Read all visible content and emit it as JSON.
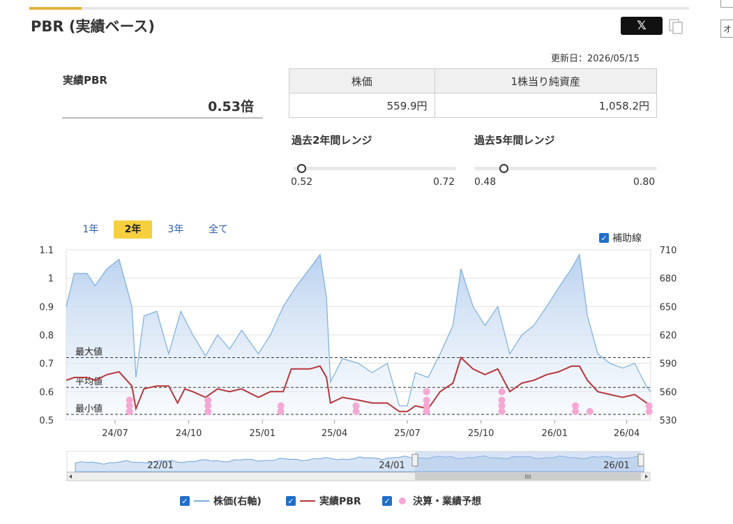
{
  "header": {
    "title": "PBR (実績ベース)",
    "share_label": "𝕏",
    "share_icon": "x-logo-icon",
    "copy_icon": "copy-icon",
    "edge_text": "オ"
  },
  "updated": "更新日：2026/05/15",
  "pbr": {
    "label": "実績PBR",
    "value": "0.53倍"
  },
  "info_table": {
    "headers": [
      "株価",
      "1株当り純資産"
    ],
    "values": [
      "559.9円",
      "1,058.2円"
    ]
  },
  "ranges": [
    {
      "title": "過去2年間レンジ",
      "min": "0.52",
      "max": "0.72",
      "position": 0.05
    },
    {
      "title": "過去5年間レンジ",
      "min": "0.48",
      "max": "0.80",
      "position": 0.16
    }
  ],
  "periods": [
    {
      "label": "1年",
      "active": false
    },
    {
      "label": "2年",
      "active": true
    },
    {
      "label": "3年",
      "active": false
    },
    {
      "label": "全て",
      "active": false
    }
  ],
  "aux_label": "補助線",
  "navigator_labels": [
    "22/01",
    "24/01",
    "26/01"
  ],
  "legend": [
    {
      "label": "株価(右軸)",
      "color": "#7aaedc"
    },
    {
      "label": "実績PBR",
      "color": "#b5363a"
    },
    {
      "label": "決算・業績予想",
      "color": "#f5a8d4"
    }
  ],
  "colors": {
    "price": "#7aaedc",
    "pbr": "#b5363a",
    "event": "#f5a8d4",
    "accent": "#f5cf3e",
    "checkbox": "#1f6fc9"
  },
  "chart_data": {
    "type": "line",
    "x_ticks": [
      "24/07",
      "24/10",
      "25/01",
      "25/04",
      "25/07",
      "25/10",
      "26/01",
      "26/04"
    ],
    "left_axis": {
      "ticks": [
        "1.1",
        "1",
        "0.9",
        "0.8",
        "0.7",
        "0.6",
        "0.5"
      ],
      "range": [
        0.5,
        1.1
      ]
    },
    "right_axis": {
      "ticks": [
        "710",
        "680",
        "650",
        "620",
        "590",
        "560",
        "530"
      ],
      "range": [
        530,
        710
      ]
    },
    "reference_lines": [
      {
        "label": "最大値",
        "value": 0.72
      },
      {
        "label": "平均値",
        "value": 0.615
      },
      {
        "label": "最小値",
        "value": 0.52
      }
    ],
    "x_range": [
      "2024-05-15",
      "2026-05-15"
    ],
    "series": [
      {
        "name": "株価(右軸)",
        "axis": "right",
        "points": [
          [
            "2024-05-15",
            650
          ],
          [
            "2024-05-25",
            685
          ],
          [
            "2024-06-10",
            685
          ],
          [
            "2024-06-20",
            672
          ],
          [
            "2024-07-05",
            690
          ],
          [
            "2024-07-20",
            700
          ],
          [
            "2024-08-05",
            650
          ],
          [
            "2024-08-10",
            575
          ],
          [
            "2024-08-20",
            640
          ],
          [
            "2024-09-05",
            645
          ],
          [
            "2024-09-20",
            600
          ],
          [
            "2024-10-05",
            645
          ],
          [
            "2024-10-20",
            620
          ],
          [
            "2024-11-05",
            598
          ],
          [
            "2024-11-20",
            620
          ],
          [
            "2024-12-05",
            605
          ],
          [
            "2024-12-20",
            625
          ],
          [
            "2025-01-10",
            600
          ],
          [
            "2025-01-25",
            620
          ],
          [
            "2025-02-10",
            650
          ],
          [
            "2025-02-25",
            670
          ],
          [
            "2025-03-15",
            690
          ],
          [
            "2025-03-28",
            705
          ],
          [
            "2025-04-05",
            660
          ],
          [
            "2025-04-10",
            570
          ],
          [
            "2025-04-25",
            595
          ],
          [
            "2025-05-15",
            590
          ],
          [
            "2025-06-01",
            580
          ],
          [
            "2025-06-20",
            590
          ],
          [
            "2025-07-05",
            545
          ],
          [
            "2025-07-15",
            545
          ],
          [
            "2025-07-25",
            580
          ],
          [
            "2025-08-10",
            575
          ],
          [
            "2025-08-25",
            600
          ],
          [
            "2025-09-10",
            630
          ],
          [
            "2025-09-20",
            690
          ],
          [
            "2025-10-05",
            650
          ],
          [
            "2025-10-20",
            630
          ],
          [
            "2025-11-05",
            650
          ],
          [
            "2025-11-20",
            600
          ],
          [
            "2025-12-05",
            620
          ],
          [
            "2025-12-20",
            630
          ],
          [
            "2026-01-05",
            650
          ],
          [
            "2026-01-20",
            670
          ],
          [
            "2026-02-05",
            690
          ],
          [
            "2026-02-15",
            705
          ],
          [
            "2026-02-25",
            640
          ],
          [
            "2026-03-10",
            600
          ],
          [
            "2026-03-25",
            590
          ],
          [
            "2026-04-10",
            585
          ],
          [
            "2026-04-25",
            590
          ],
          [
            "2026-05-10",
            565
          ],
          [
            "2026-05-15",
            560
          ]
        ]
      },
      {
        "name": "実績PBR",
        "axis": "left",
        "points": [
          [
            "2024-05-15",
            0.64
          ],
          [
            "2024-05-25",
            0.65
          ],
          [
            "2024-06-10",
            0.65
          ],
          [
            "2024-06-20",
            0.64
          ],
          [
            "2024-07-05",
            0.66
          ],
          [
            "2024-07-20",
            0.67
          ],
          [
            "2024-08-05",
            0.62
          ],
          [
            "2024-08-10",
            0.54
          ],
          [
            "2024-08-20",
            0.61
          ],
          [
            "2024-09-05",
            0.62
          ],
          [
            "2024-09-20",
            0.62
          ],
          [
            "2024-10-01",
            0.56
          ],
          [
            "2024-10-10",
            0.61
          ],
          [
            "2024-10-20",
            0.6
          ],
          [
            "2024-11-05",
            0.58
          ],
          [
            "2024-11-20",
            0.61
          ],
          [
            "2024-12-05",
            0.6
          ],
          [
            "2024-12-20",
            0.61
          ],
          [
            "2025-01-10",
            0.58
          ],
          [
            "2025-01-25",
            0.6
          ],
          [
            "2025-02-10",
            0.6
          ],
          [
            "2025-02-20",
            0.68
          ],
          [
            "2025-03-15",
            0.68
          ],
          [
            "2025-03-28",
            0.69
          ],
          [
            "2025-04-05",
            0.65
          ],
          [
            "2025-04-10",
            0.56
          ],
          [
            "2025-04-25",
            0.58
          ],
          [
            "2025-05-15",
            0.57
          ],
          [
            "2025-06-01",
            0.56
          ],
          [
            "2025-06-20",
            0.56
          ],
          [
            "2025-07-05",
            0.53
          ],
          [
            "2025-07-15",
            0.53
          ],
          [
            "2025-07-25",
            0.55
          ],
          [
            "2025-08-10",
            0.54
          ],
          [
            "2025-08-25",
            0.6
          ],
          [
            "2025-09-10",
            0.63
          ],
          [
            "2025-09-20",
            0.72
          ],
          [
            "2025-10-05",
            0.68
          ],
          [
            "2025-10-20",
            0.66
          ],
          [
            "2025-11-05",
            0.68
          ],
          [
            "2025-11-20",
            0.6
          ],
          [
            "2025-12-05",
            0.63
          ],
          [
            "2025-12-20",
            0.64
          ],
          [
            "2026-01-05",
            0.66
          ],
          [
            "2026-01-20",
            0.67
          ],
          [
            "2026-02-05",
            0.69
          ],
          [
            "2026-02-15",
            0.69
          ],
          [
            "2026-02-25",
            0.64
          ],
          [
            "2026-03-10",
            0.6
          ],
          [
            "2026-03-25",
            0.59
          ],
          [
            "2026-04-10",
            0.58
          ],
          [
            "2026-04-25",
            0.59
          ],
          [
            "2026-05-10",
            0.56
          ],
          [
            "2026-05-15",
            0.55
          ]
        ]
      }
    ],
    "events": [
      {
        "name": "決算・業績予想",
        "x": "2024-08-02",
        "y": [
          0.53,
          0.55,
          0.57
        ]
      },
      {
        "name": "決算・業績予想",
        "x": "2024-11-08",
        "y": [
          0.53,
          0.55,
          0.57
        ]
      },
      {
        "name": "決算・業績予想",
        "x": "2025-02-07",
        "y": [
          0.53,
          0.55
        ]
      },
      {
        "name": "決算・業績予想",
        "x": "2025-05-12",
        "y": [
          0.53,
          0.55
        ]
      },
      {
        "name": "決算・業績予想",
        "x": "2025-08-08",
        "y": [
          0.53,
          0.55,
          0.57,
          0.6
        ]
      },
      {
        "name": "決算・業績予想",
        "x": "2025-11-10",
        "y": [
          0.53,
          0.55,
          0.57,
          0.6
        ]
      },
      {
        "name": "決算・業績予想",
        "x": "2026-02-10",
        "y": [
          0.53,
          0.55
        ]
      },
      {
        "name": "決算・業績予想",
        "x": "2026-02-28",
        "y": [
          0.53
        ]
      },
      {
        "name": "決算・業績予想",
        "x": "2026-05-13",
        "y": [
          0.53,
          0.55
        ]
      }
    ]
  }
}
